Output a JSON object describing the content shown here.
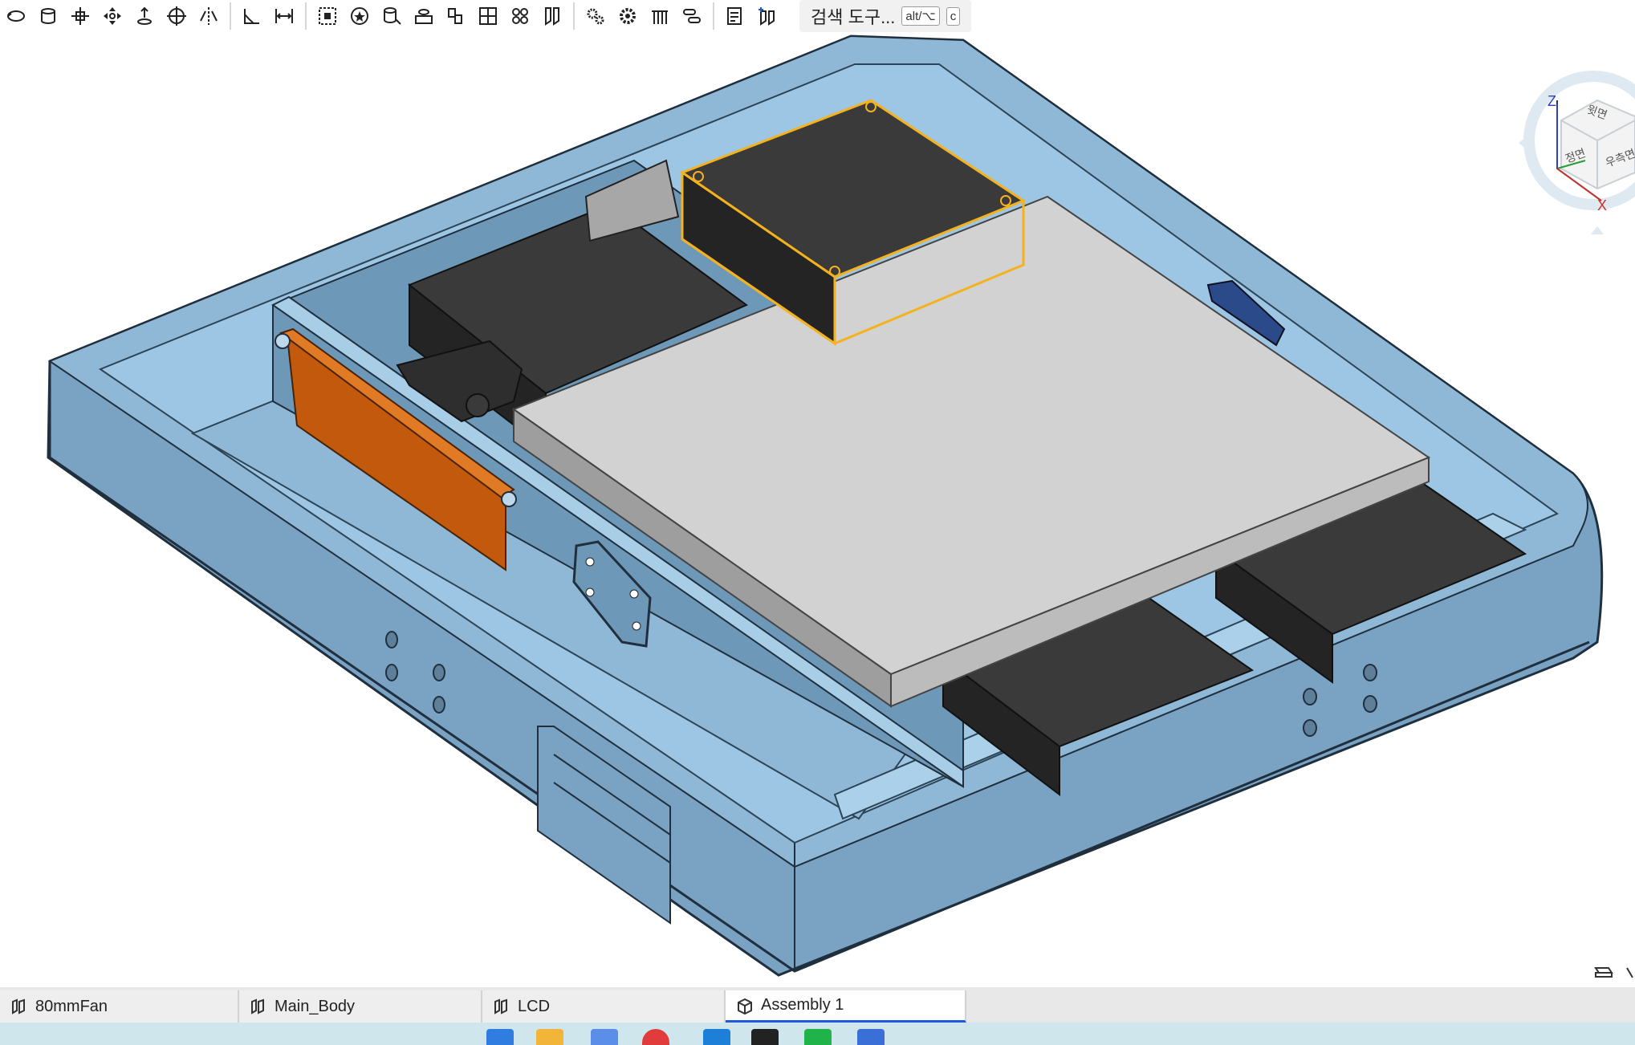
{
  "toolbar": {
    "search_label": "검색 도구...",
    "shortcut_modifier": "alt/⌥",
    "shortcut_key": "c"
  },
  "view_cube": {
    "axis_z": "Z",
    "axis_x": "X",
    "face_top": "윗면",
    "face_front": "정면",
    "face_right": "우측면"
  },
  "tabs": [
    {
      "label": "80mmFan",
      "active": false
    },
    {
      "label": "Main_Body",
      "active": false
    },
    {
      "label": "LCD",
      "active": false
    },
    {
      "label": "Assembly 1",
      "active": true
    }
  ],
  "colors": {
    "housing": "#8fb8d6",
    "housing_dark": "#4f6f88",
    "dark_part": "#3a3a3a",
    "lcd_panel": "#d2d2d2",
    "handle": "#c2590c",
    "selection": "#f5b21f",
    "active_tab_accent": "#1e5bd8"
  }
}
